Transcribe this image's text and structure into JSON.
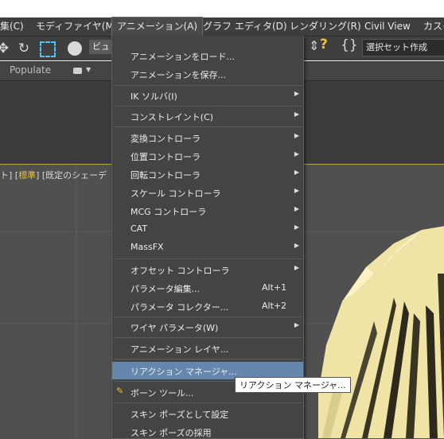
{
  "menubar": {
    "items": [
      {
        "label": "集(C)"
      },
      {
        "label": "モディファイヤ(M)"
      },
      {
        "label": "アニメーション(A)"
      },
      {
        "label": "グラフ エディタ(D)"
      },
      {
        "label": "レンダリング(R)"
      },
      {
        "label": "Civil View"
      },
      {
        "label": "カスタ"
      }
    ]
  },
  "toolbar": {
    "view_combo": "ビュー",
    "selection_set": "選択セット作成"
  },
  "ribbon": {
    "populate": "Populate"
  },
  "viewport": {
    "label_prefix": "ト] [",
    "label_std": "標準",
    "label_suffix": "] [既定のシェーデ"
  },
  "menu": {
    "items": [
      {
        "label": "アニメーションをロード...",
        "shortcut": "",
        "submenu": false
      },
      {
        "label": "アニメーションを保存...",
        "shortcut": "",
        "submenu": false
      },
      {
        "label": "IK ソルバ(I)",
        "shortcut": "",
        "submenu": true
      },
      {
        "label": "コンストレイント(C)",
        "shortcut": "",
        "submenu": true
      },
      {
        "label": "変換コントローラ",
        "shortcut": "",
        "submenu": true
      },
      {
        "label": "位置コントローラ",
        "shortcut": "",
        "submenu": true
      },
      {
        "label": "回転コントローラ",
        "shortcut": "",
        "submenu": true
      },
      {
        "label": "スケール コントローラ",
        "shortcut": "",
        "submenu": true
      },
      {
        "label": "MCG コントローラ",
        "shortcut": "",
        "submenu": true
      },
      {
        "label": "CAT",
        "shortcut": "",
        "submenu": true
      },
      {
        "label": "MassFX",
        "shortcut": "",
        "submenu": true
      },
      {
        "label": "オフセット コントローラ",
        "shortcut": "",
        "submenu": true
      },
      {
        "label": "パラメータ編集...",
        "shortcut": "Alt+1",
        "submenu": false
      },
      {
        "label": "パラメータ コレクター...",
        "shortcut": "Alt+2",
        "submenu": false
      },
      {
        "label": "ワイヤ パラメータ(W)",
        "shortcut": "",
        "submenu": true
      },
      {
        "label": "アニメーション レイヤ...",
        "shortcut": "",
        "submenu": false
      },
      {
        "label": "リアクション マネージャ...",
        "shortcut": "",
        "submenu": false
      },
      {
        "label": "ボーン ツール...",
        "shortcut": "",
        "submenu": false
      },
      {
        "label": "スキン ポーズとして設定",
        "shortcut": "",
        "submenu": false
      },
      {
        "label": "スキン ポーズの採用",
        "shortcut": "",
        "submenu": false
      }
    ]
  },
  "tooltip": "リアクション マネージャ...",
  "colors": {
    "menu_bg": "#444444",
    "highlight": "#6587ae",
    "hair": "#efe3a6",
    "accent": "#f1c232"
  }
}
